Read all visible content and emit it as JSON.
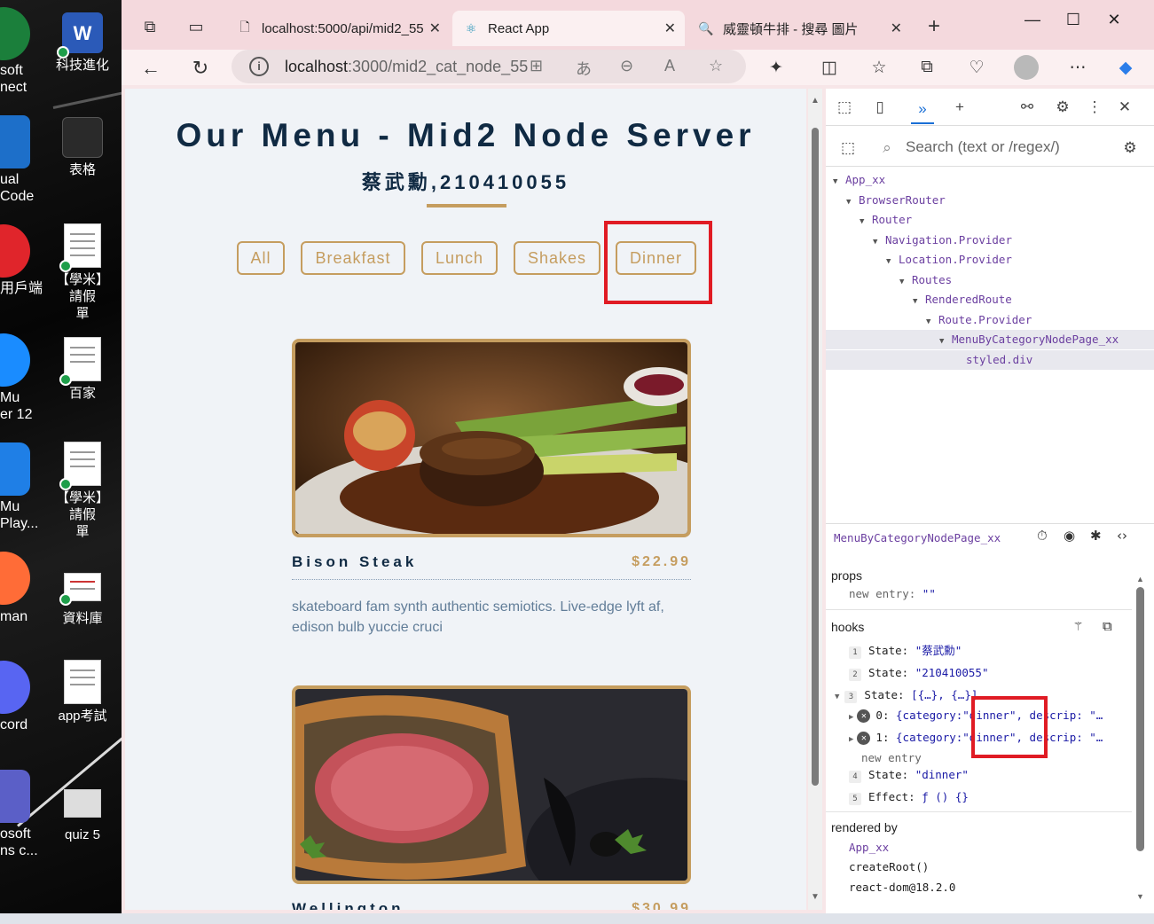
{
  "desktop": {
    "left_labels": [
      {
        "line1": "soft",
        "line2": "nect"
      },
      {
        "line1": "ual",
        "line2": " Code"
      },
      {
        "line1": "用戶端",
        "line2": ""
      },
      {
        "line1": "Mu",
        "line2": "er 12"
      },
      {
        "line1": "Mu",
        "line2": "Play..."
      },
      {
        "line1": "man",
        "line2": ""
      },
      {
        "line1": "cord",
        "line2": ""
      },
      {
        "line1": "osoft",
        "line2": "ns c..."
      }
    ],
    "icons": [
      {
        "label1": "科技進化",
        "label2": ""
      },
      {
        "label1": "表格",
        "label2": ""
      },
      {
        "label1": "【學米】請假",
        "label2": "單"
      },
      {
        "label1": "百家",
        "label2": ""
      },
      {
        "label1": "【學米】請假",
        "label2": "單"
      },
      {
        "label1": "資料庫",
        "label2": ""
      },
      {
        "label1": "app考試",
        "label2": ""
      },
      {
        "label1": "quiz 5",
        "label2": ""
      }
    ]
  },
  "browser": {
    "tabs": [
      {
        "title": "localhost:5000/api/mid2_55",
        "icon": "page-icon"
      },
      {
        "title": "React App",
        "icon": "react-icon"
      },
      {
        "title": "威靈頓牛排 - 搜尋 圖片",
        "icon": "search-icon"
      }
    ],
    "url_host": "localhost",
    "url_path": ":3000/mid2_cat_node_55"
  },
  "page": {
    "title": "Our Menu - Mid2 Node Server",
    "subtitle": "蔡武勳,210410055",
    "categories": [
      "All",
      "Breakfast",
      "Lunch",
      "Shakes",
      "Dinner"
    ],
    "items": [
      {
        "name": "Bison Steak",
        "price": "$22.99",
        "desc": "skateboard fam synth authentic semiotics. Live-edge lyft af, edison bulb yuccie cruci"
      },
      {
        "name": "Wellington",
        "price": "$30.99"
      }
    ],
    "accent_color": "#c59d5f",
    "title_color": "#102a43"
  },
  "devtools": {
    "search_placeholder": "Search (text or /regex/)",
    "tree": [
      "App_xx",
      "BrowserRouter",
      "Router",
      "Navigation.Provider",
      "Location.Provider",
      "Routes",
      "RenderedRoute",
      "Route.Provider",
      "MenuByCategoryNodePage_xx",
      "styled.div"
    ],
    "selected_component": "MenuByCategoryNodePage_xx",
    "props_title": "props",
    "props_new_entry": "new entry:",
    "props_new_entry_val": "\"\"",
    "hooks_title": "hooks",
    "hooks": {
      "h1_label": "State:",
      "h1_val": "\"蔡武勳\"",
      "h2_label": "State:",
      "h2_val": "\"210410055\"",
      "h3_label": "State:",
      "h3_val": "[{…}, {…}]",
      "h3_item0_key": "0:",
      "h3_item0_pre": "{category:",
      "h3_item0_cat": "\"dinner\"",
      "h3_item0_post": ", descrip: \"…",
      "h3_item1_key": "1:",
      "h3_item1_pre": "{category:",
      "h3_item1_cat": "\"dinner\"",
      "h3_item1_post": ", descrip: \"…",
      "new_entry": "new entry",
      "h4_label": "State:",
      "h4_val": "\"dinner\"",
      "h5_label": "Effect:",
      "h5_val": "ƒ () {}"
    },
    "rendered_by_title": "rendered by",
    "rendered_by": [
      "App_xx",
      "createRoot()",
      "react-dom@18.2.0"
    ]
  }
}
